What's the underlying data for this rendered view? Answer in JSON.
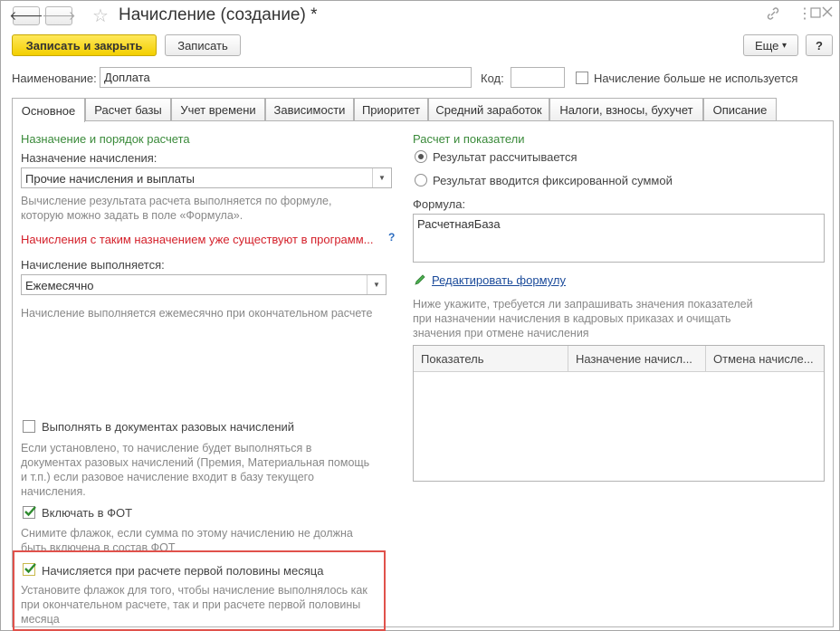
{
  "window": {
    "title": "Начисление (создание) *"
  },
  "toolbar": {
    "save_close": "Записать и закрыть",
    "save": "Записать",
    "more": "Еще",
    "more_arrow": "▾",
    "help": "?"
  },
  "header": {
    "name_label": "Наименование:",
    "name_value": "Доплата",
    "code_label": "Код:",
    "code_value": "",
    "unused_label": "Начисление больше не используется"
  },
  "tabs": [
    "Основное",
    "Расчет базы",
    "Учет времени",
    "Зависимости",
    "Приоритет",
    "Средний заработок",
    "Налоги, взносы, бухучет",
    "Описание"
  ],
  "left": {
    "section_title": "Назначение и порядок расчета",
    "purpose_label": "Назначение начисления:",
    "purpose_value": "Прочие начисления и выплаты",
    "purpose_hint_1": "Вычисление результата расчета выполняется по формуле,",
    "purpose_hint_2": "которую можно задать в поле «Формула».",
    "warning": "Начисления с таким назначением уже существуют в программ...",
    "warning_help": "?",
    "execute_label": "Начисление выполняется:",
    "execute_value": "Ежемесячно",
    "execute_hint": "Начисление выполняется ежемесячно при окончательном расчете",
    "onetime_label": "Выполнять в документах разовых начислений",
    "onetime_hint": [
      "Если установлено, то начисление будет выполняться в",
      "документах разовых начислений (Премия, Материальная помощь",
      "и т.п.) если разовое начисление входит в базу текущего",
      "начисления."
    ],
    "fot_label": "Включать в ФОТ",
    "fot_hint": [
      "Снимите флажок, если сумма по этому начислению не должна",
      "быть включена в состав ФОТ"
    ],
    "half_label": "Начисляется при расчете первой половины месяца",
    "half_hint": [
      "Установите флажок для того, чтобы начисление выполнялось как",
      "при окончательном расчете, так и при расчете первой половины",
      "месяца"
    ]
  },
  "right": {
    "section_title": "Расчет и показатели",
    "radio_calculated": "Результат рассчитывается",
    "radio_fixed": "Результат вводится фиксированной суммой",
    "formula_label": "Формула:",
    "formula_value": "РасчетнаяБаза",
    "edit_formula": "Редактировать формулу",
    "indicators_hint": [
      "Ниже укажите, требуется ли запрашивать значения показателей",
      "при назначении начисления в кадровых приказах и очищать",
      "значения при отмене начисления"
    ],
    "table_columns": [
      "Показатель",
      "Назначение начисл...",
      "Отмена начисле..."
    ]
  },
  "icons": [
    "back-arrow-icon",
    "forward-arrow-icon",
    "star-icon",
    "link-icon",
    "more-vertical-icon",
    "maximize-icon",
    "close-icon",
    "pencil-icon",
    "check-icon"
  ]
}
